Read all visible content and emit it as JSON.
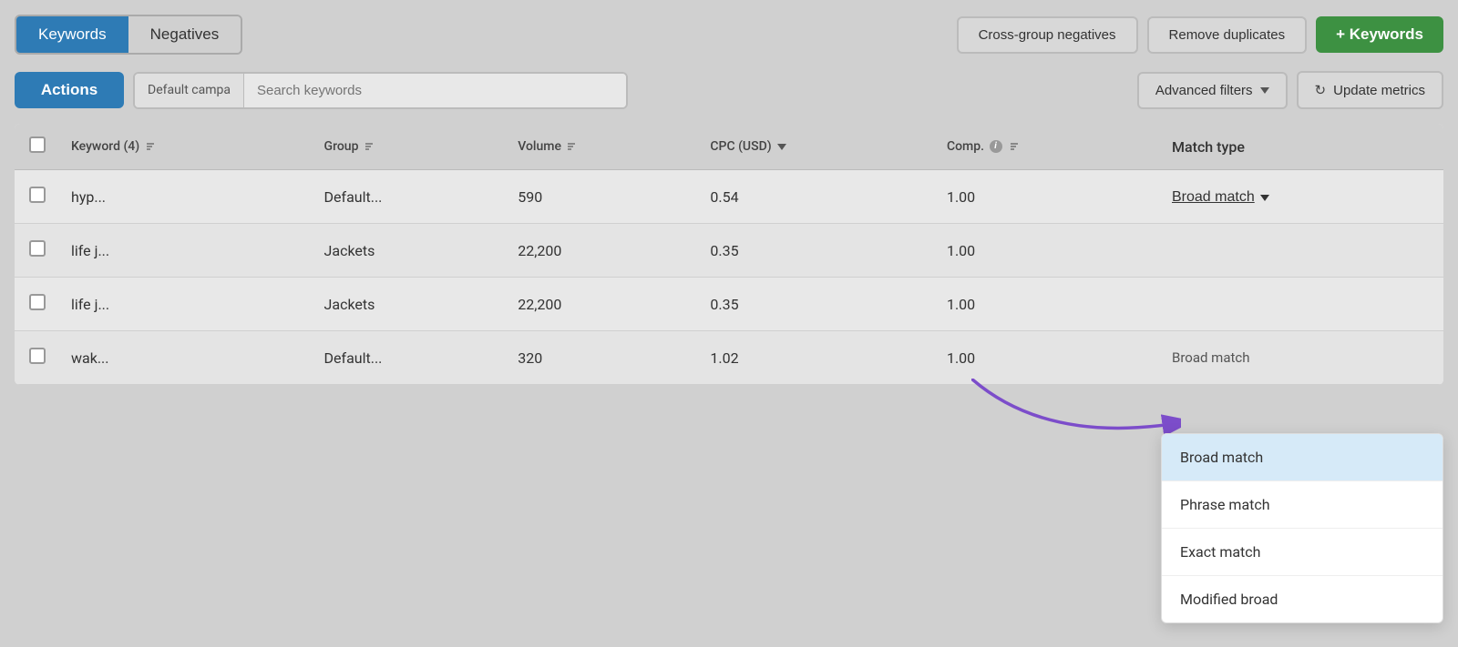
{
  "tabs": {
    "keywords_label": "Keywords",
    "negatives_label": "Negatives"
  },
  "header_buttons": {
    "cross_group": "Cross-group negatives",
    "remove_duplicates": "Remove duplicates",
    "add_keywords": "+ Keywords"
  },
  "toolbar": {
    "actions_label": "Actions",
    "campaign_placeholder": "Default campa",
    "search_placeholder": "Search keywords",
    "advanced_filters_label": "Advanced filters",
    "update_metrics_label": "Update metrics"
  },
  "table": {
    "headers": {
      "keyword": "Keyword (4)",
      "group": "Group",
      "volume": "Volume",
      "cpc": "CPC (USD)",
      "comp": "Comp.",
      "match_type": "Match type"
    },
    "rows": [
      {
        "keyword": "hyp...",
        "group": "Default...",
        "volume": "590",
        "cpc": "0.54",
        "comp": "1.00",
        "match_type": "Broad match",
        "show_dropdown": true
      },
      {
        "keyword": "life j...",
        "group": "Jackets",
        "volume": "22,200",
        "cpc": "0.35",
        "comp": "1.00",
        "match_type": "",
        "show_dropdown": false
      },
      {
        "keyword": "life j...",
        "group": "Jackets",
        "volume": "22,200",
        "cpc": "0.35",
        "comp": "1.00",
        "match_type": "",
        "show_dropdown": false
      },
      {
        "keyword": "wak...",
        "group": "Default...",
        "volume": "320",
        "cpc": "1.02",
        "comp": "1.00",
        "match_type": "Broad match",
        "show_dropdown": false,
        "last_row": true
      }
    ]
  },
  "dropdown_options": [
    {
      "label": "Broad match",
      "selected": true
    },
    {
      "label": "Phrase match",
      "selected": false
    },
    {
      "label": "Exact match",
      "selected": false
    },
    {
      "label": "Modified broad",
      "selected": false
    }
  ]
}
